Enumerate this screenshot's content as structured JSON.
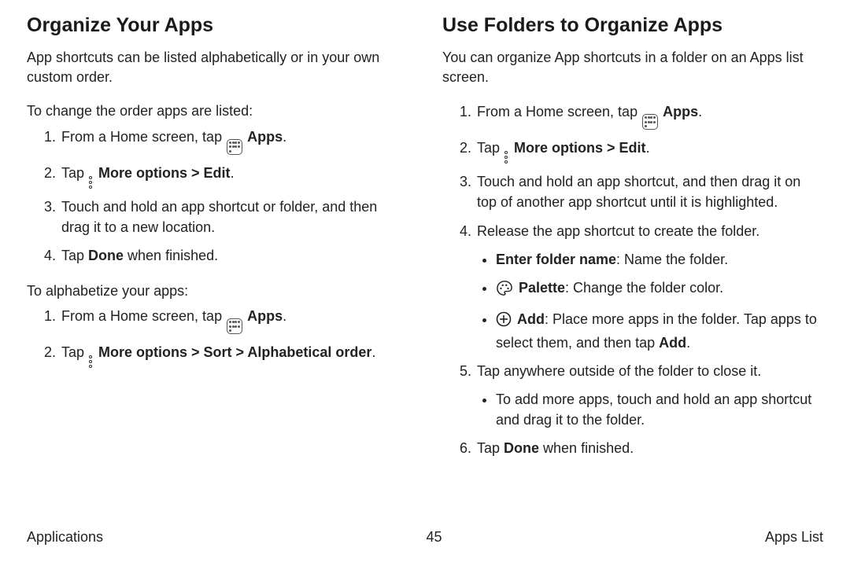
{
  "left": {
    "heading": "Organize Your Apps",
    "intro": "App shortcuts can be listed alphabetically or in your own custom order.",
    "changeOrder": {
      "lead": "To change the order apps are listed:",
      "step1_pre": "From a Home screen, tap ",
      "step1_apps": "Apps",
      "step1_post": ".",
      "step2_pre": "Tap ",
      "step2_bold": "More options > Edit",
      "step2_post": ".",
      "step3": "Touch and hold an app shortcut or folder, and then drag it to a new location.",
      "step4_pre": "Tap ",
      "step4_bold": "Done",
      "step4_post": " when finished."
    },
    "alpha": {
      "lead": "To alphabetize your apps:",
      "step1_pre": "From a Home screen, tap ",
      "step1_apps": "Apps",
      "step1_post": ".",
      "step2_pre": "Tap ",
      "step2_bold": "More options > Sort > Alphabetical order",
      "step2_post": "."
    }
  },
  "right": {
    "heading": "Use Folders to Organize Apps",
    "intro": "You can organize App shortcuts in a folder on an Apps list screen.",
    "step1_pre": "From a Home screen, tap ",
    "step1_apps": "Apps",
    "step1_post": ".",
    "step2_pre": "Tap ",
    "step2_bold": "More options > Edit",
    "step2_post": ".",
    "step3": "Touch and hold an app shortcut, and then drag it on top of another app shortcut until it is highlighted.",
    "step4": "Release the app shortcut to create the folder.",
    "sub_enter_bold": "Enter folder name",
    "sub_enter_post": ": Name the folder.",
    "sub_palette_bold": "Palette",
    "sub_palette_post": ": Change the folder color.",
    "sub_add_bold": "Add",
    "sub_add_mid": ": Place more apps in the folder. Tap apps to select them, and then tap ",
    "sub_add_bold2": "Add",
    "sub_add_post": ".",
    "step5": "Tap anywhere outside of the folder to close it.",
    "sub5": "To add more apps, touch and hold an app shortcut and drag it to the folder.",
    "step6_pre": "Tap ",
    "step6_bold": "Done",
    "step6_post": " when finished."
  },
  "footer": {
    "left": "Applications",
    "center": "45",
    "right": "Apps List"
  }
}
